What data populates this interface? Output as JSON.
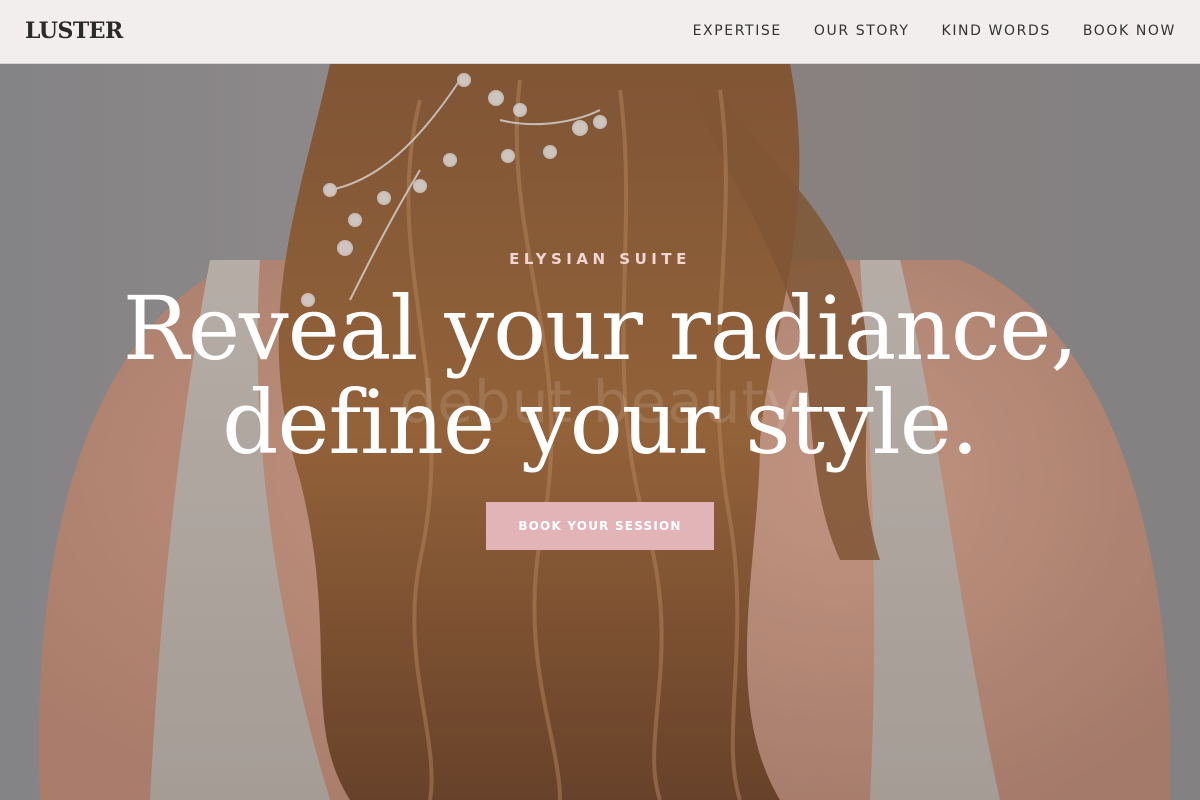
{
  "header": {
    "logo": "LUSTER",
    "nav": [
      {
        "label": "EXPERTISE"
      },
      {
        "label": "OUR STORY"
      },
      {
        "label": "KIND WORDS"
      },
      {
        "label": "BOOK NOW"
      }
    ]
  },
  "hero": {
    "eyebrow": "ELYSIAN SUITE",
    "headline_line1": "Reveal your radiance,",
    "headline_line2": "define your style.",
    "background_watermark": "debut beauty",
    "cta_label": "BOOK YOUR SESSION"
  },
  "colors": {
    "accent_pink": "#e2b3b7",
    "eyebrow_pink": "#f1d6d3",
    "header_bg": "#f7f3f2",
    "text_dark": "#2a2a2a"
  }
}
